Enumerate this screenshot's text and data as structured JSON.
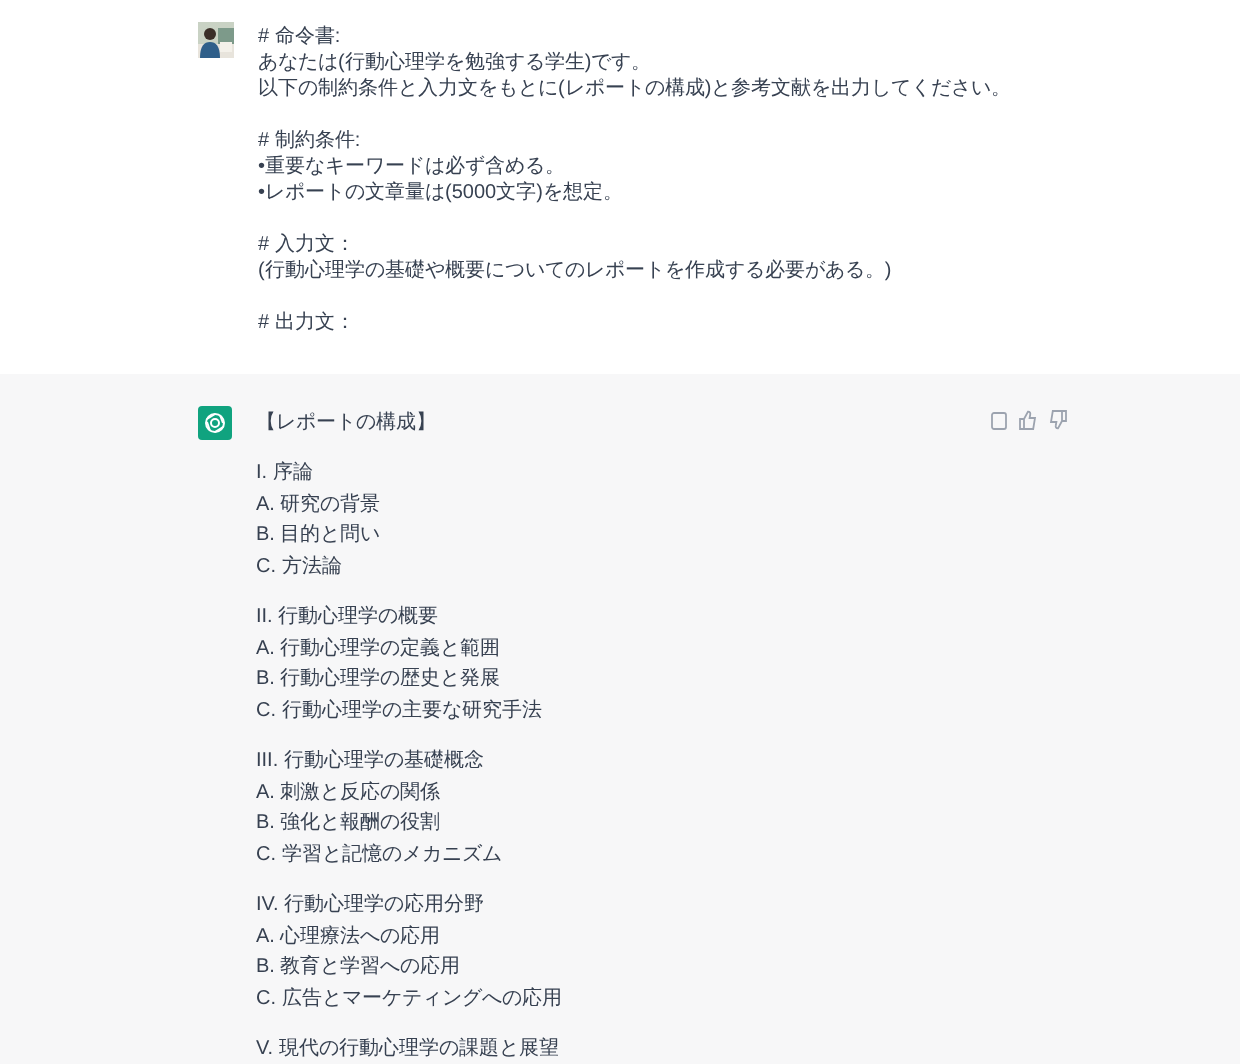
{
  "user_message": {
    "avatar": {
      "kind": "picture"
    },
    "paragraphs": [
      [
        "# 命令書:",
        "あなたは(行動心理学を勉強する学生)です。",
        "以下の制約条件と入力文をもとに(レポートの構成)と参考文献を出力してください。"
      ],
      [
        "# 制約条件:",
        "•重要なキーワードは必ず含める。",
        "•レポートの文章量は(5000文字)を想定。"
      ],
      [
        "# 入力文：",
        "(行動心理学の基礎や概要についてのレポートを作成する必要がある。)"
      ],
      [
        "# 出力文："
      ]
    ]
  },
  "assistant_message": {
    "heading": "【レポートの構成】",
    "sections": [
      {
        "title": "I. 序論",
        "items": [
          "A. 研究の背景",
          "B. 目的と問い",
          "C. 方法論"
        ]
      },
      {
        "title": "II. 行動心理学の概要",
        "items": [
          "A. 行動心理学の定義と範囲",
          "B. 行動心理学の歴史と発展",
          "C. 行動心理学の主要な研究手法"
        ]
      },
      {
        "title": "III. 行動心理学の基礎概念",
        "items": [
          "A. 刺激と反応の関係",
          "B. 強化と報酬の役割",
          "C. 学習と記憶のメカニズム"
        ]
      },
      {
        "title": "IV. 行動心理学の応用分野",
        "items": [
          "A. 心理療法への応用",
          "B. 教育と学習への応用",
          "C. 広告とマーケティングへの応用"
        ]
      },
      {
        "title": "V. 現代の行動心理学の課題と展望"
      }
    ]
  }
}
